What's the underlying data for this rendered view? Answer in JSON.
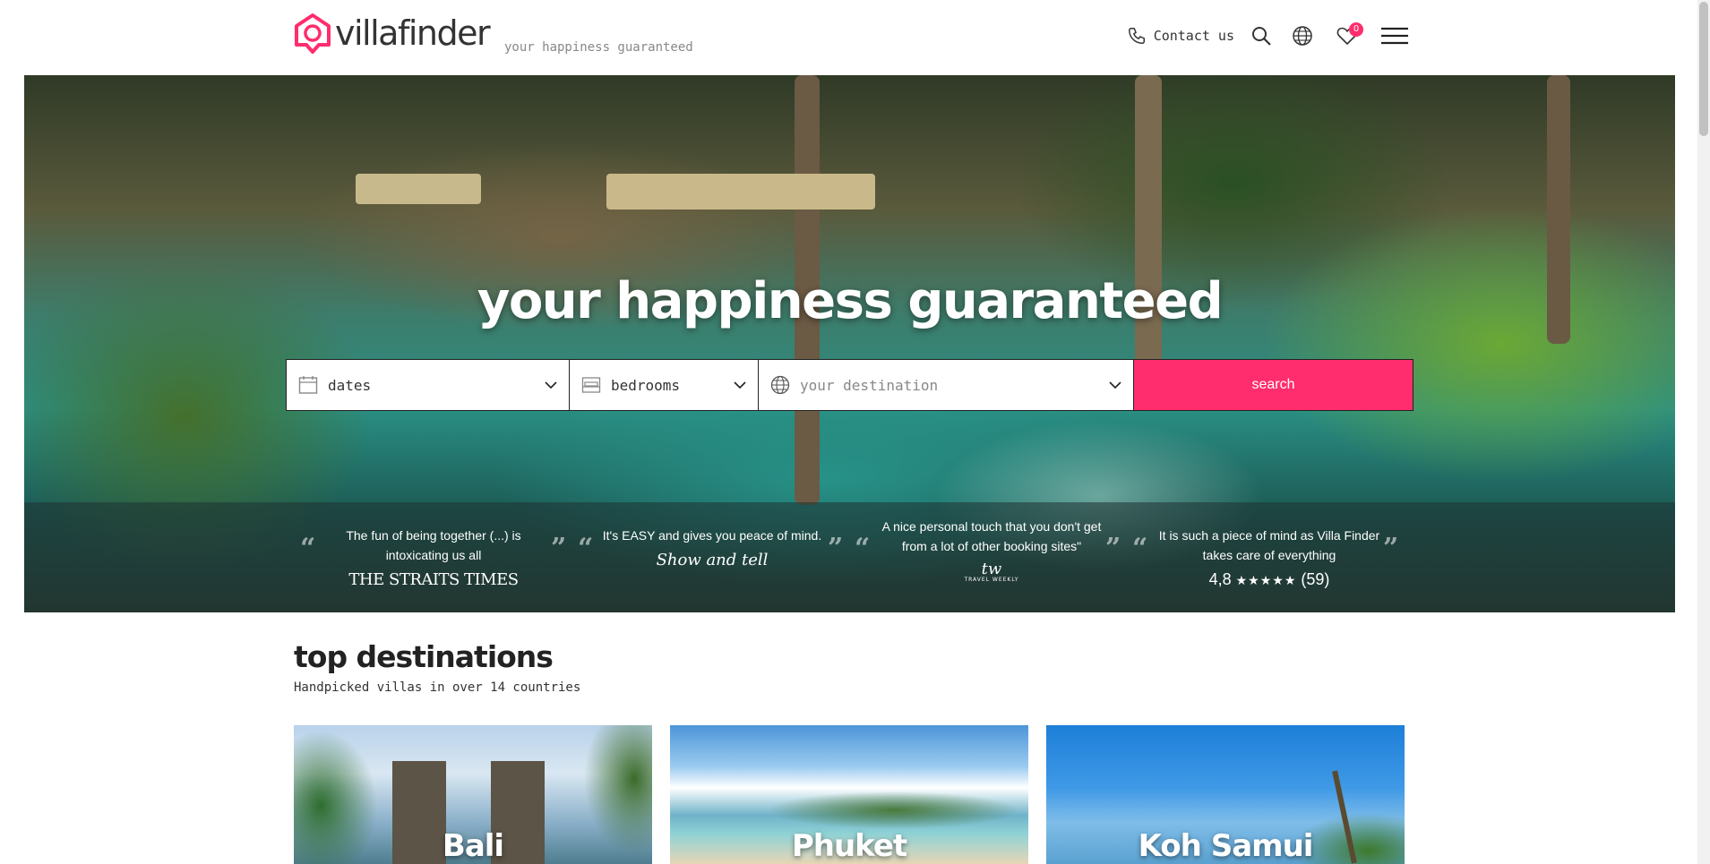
{
  "brand": {
    "logo_text_bold": "villa",
    "logo_text_light": "finder",
    "tagline": "your happiness guaranteed",
    "accent_color": "#ff2d6d"
  },
  "nav": {
    "contact_label": "Contact us",
    "favorites_count": "0",
    "icons": [
      "phone-icon",
      "search-icon",
      "globe-icon",
      "heart-icon",
      "menu-icon"
    ]
  },
  "hero": {
    "title": "your happiness guaranteed",
    "search": {
      "dates_label": "dates",
      "bedrooms_label": "bedrooms",
      "destination_placeholder": "your destination",
      "search_button": "search"
    },
    "testimonials": [
      {
        "quote": "The fun of being together (...) is intoxicating us all",
        "source": "THE STRAITS TIMES"
      },
      {
        "quote": "It's EASY and gives you peace of mind.",
        "source": "Show and tell"
      },
      {
        "quote": "A nice personal touch that you don't get from a lot of other booking sites\"",
        "source": "tw",
        "source_sub": "TRAVEL WEEKLY"
      },
      {
        "quote": "It is such a piece of mind as Villa Finder takes care of everything",
        "rating": "4,8",
        "stars": "★★★★★",
        "count": "(59)"
      }
    ]
  },
  "destinations": {
    "title": "top destinations",
    "subtitle": "Handpicked villas in over 14 countries",
    "cards": [
      {
        "name": "Bali"
      },
      {
        "name": "Phuket"
      },
      {
        "name": "Koh Samui"
      }
    ]
  }
}
